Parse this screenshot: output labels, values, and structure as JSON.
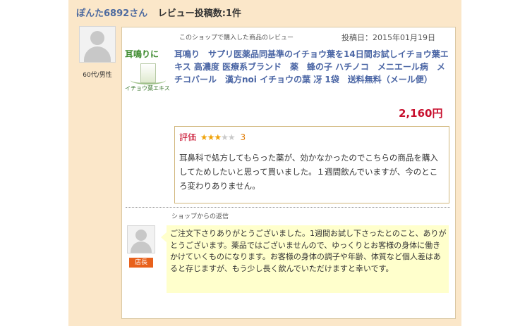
{
  "reviewer": {
    "name": "ぽんた6892さん",
    "review_count": "レビュー投稿数:1件",
    "age_gender": "60代/男性"
  },
  "review": {
    "shop_note": "このショップで購入した商品のレビュー",
    "post_date": "投稿日：2015年01月19日",
    "product_title": "耳鳴り　サプリ医薬品同基準のイチョウ葉を14日間お試しイチョウ葉エキス 高濃度 医療系ブランド　薬　蜂の子 ハチノコ　メニエール病　メチコバール　漢方noi イチョウの葉 冴 1袋　送料無料（メール便）",
    "price": "2,160円",
    "rating_label": "評価",
    "rating_value": 3,
    "rating_max": 5,
    "rating_text": "3",
    "stars_on": "★★★",
    "stars_off": "★★",
    "body": "耳鼻科で処方してもらった薬が、効かなかったのでこちらの商品を購入してためしたいと思って買いました。１週間飲んでいますが、今のところ変わりありません。"
  },
  "thumbnail": {
    "line1": "耳鳴りに",
    "line2": "イチョウ葉エキス"
  },
  "shop_reply": {
    "label": "ショップからの返信",
    "badge": "店長",
    "body": "ご注文下さりありがとうございました。1週間お試し下さったとのこと、ありがとうございます。薬品ではございませんので、ゆっくりとお客様の身体に働きかけていくものになります。お客様の身体の調子や年齢、体質など個人差はあると存じますが、もう少し長く飲んでいただけますと幸いです。"
  },
  "colors": {
    "frame_bg": "#fbe7c9",
    "link": "#4b66a5",
    "price": "#c8102e",
    "star_on": "#f0a30a",
    "reply_bg": "#ffffcc",
    "badge_bg": "#e8611c"
  }
}
